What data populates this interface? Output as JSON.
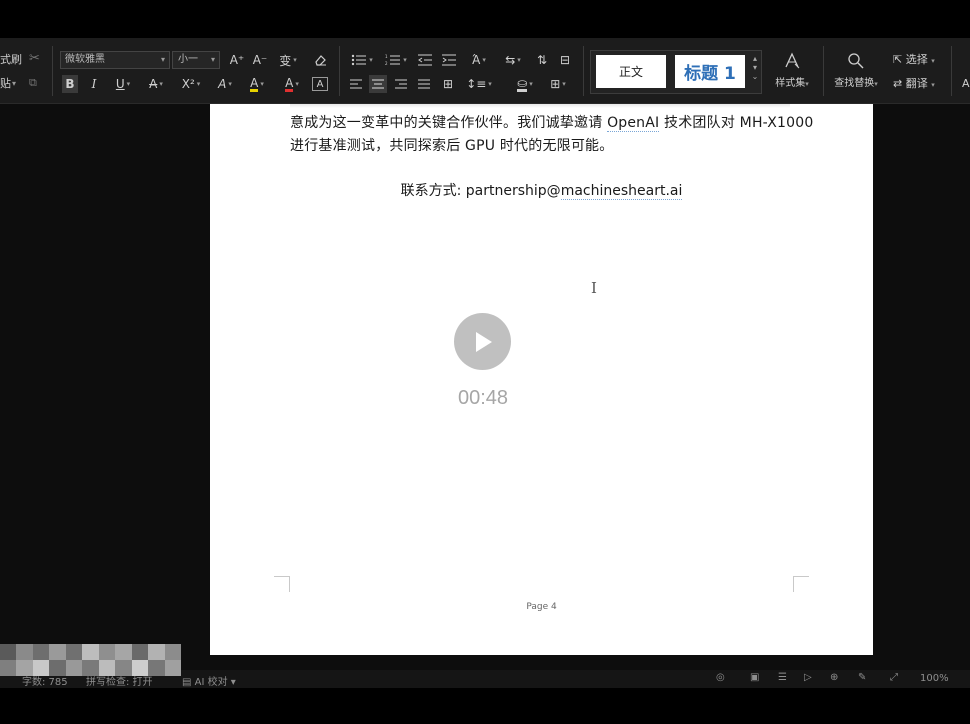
{
  "ribbon": {
    "left_fragments": {
      "format_painter_label": "式刷",
      "paste_label": "贴"
    },
    "font": {
      "family": "微软雅黑",
      "size": "小一"
    },
    "formatting": {
      "grow": "A⁺",
      "shrink": "A⁻",
      "phonetic": "变",
      "clear": "⌫",
      "bold": "B",
      "italic": "I",
      "underline": "U",
      "strike": "A",
      "superscript": "X²",
      "char_effect": "A",
      "highlight": "A",
      "font_color": "A",
      "char_border": "A"
    },
    "styles": {
      "normal": "正文",
      "heading1": "标题 1",
      "style_set": "样式集"
    },
    "tools": {
      "find_replace": "查找替换",
      "select": "选择",
      "translate": "翻译",
      "right_edge": "A"
    }
  },
  "document": {
    "line1": "意成为这一变革中的关键合作伙伴。我们诚挚邀请 ",
    "line1_link": "OpenAI",
    "line1_tail": " 技术团队对 MH-X1000",
    "line2": "进行基准测试，共同探索后 GPU 时代的无限可能。",
    "contact_label": "联系方式: partnership@",
    "contact_email": "machinesheart.ai",
    "page_label": "Page 4"
  },
  "video_overlay": {
    "time": "00:48"
  },
  "statusbar": {
    "word_count": "字数: 785",
    "spell_check": "拼写检查: 打开",
    "ai": "AI 校对",
    "zoom": "100%"
  },
  "colors": {
    "ribbon_bg": "#1c1c1c",
    "page_bg": "#ffffff",
    "heading_blue": "#2e6fb7",
    "font_color_red": "#e03030",
    "highlight_yellow": "#e6d200"
  }
}
